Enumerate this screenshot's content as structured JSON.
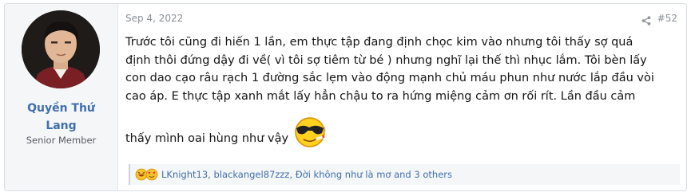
{
  "user": {
    "name_line1": "Quyền Thứ",
    "name_line2": "Lang",
    "title": "Senior Member"
  },
  "post": {
    "date": "Sep 4, 2022",
    "number": "#52",
    "body_lines": [
      "Trước tôi cũng đi hiến 1 lần, em thực tập đang định chọc kim vào nhưng tôi thấy sợ quá",
      "định thôi đứng dậy đi về( vì tôi sợ tiêm từ bé ) nhưng nghĩ lại thế thì nhục lắm. Tôi bèn lấy",
      "con dao cạo râu rạch 1 đường sắc lẹm vào động mạnh chủ máu phun như nước lắp đầu vòi",
      "cao áp. E thực tập xanh mắt lấy hẳn chậu to ra hứng miệng cảm ơn rối rít. Lần đầu cảm",
      "thấy mình oai hùng như vậy"
    ],
    "smiley_icon": "cool-smoking-smiley-icon"
  },
  "reactions": {
    "icons": [
      "laugh-reaction-icon",
      "love-reaction-icon"
    ],
    "users_text": "LKnight13, blackangel87zzz, Đời không như là mơ and 3 others"
  },
  "colors": {
    "username": "#3f6fb0",
    "meta": "#8a9097",
    "user_cell_bg": "#f5f6f8",
    "reaction_link": "#3f6fb0"
  }
}
